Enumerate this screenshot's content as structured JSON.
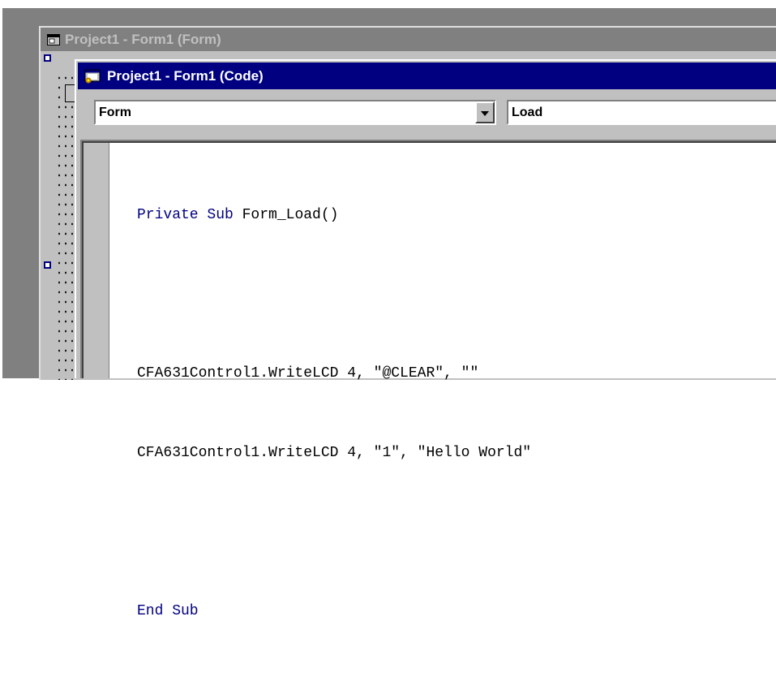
{
  "form_window": {
    "title": "Project1 - Form1 (Form)"
  },
  "code_window": {
    "title": "Project1 - Form1 (Code)",
    "object_dropdown": {
      "value": "Form"
    },
    "procedure_dropdown": {
      "value": "Load"
    }
  },
  "code": {
    "line1_kw": "Private Sub",
    "line1_rest": " Form_Load()",
    "line2": "",
    "line3": "CFA631Control1.WriteLCD 4, \"@CLEAR\", \"\"",
    "line4": "CFA631Control1.WriteLCD 4, \"1\", \"Hello World\"",
    "line5": "",
    "line6_kw": "End Sub"
  },
  "colors": {
    "active_title": "#000080",
    "inactive_title": "#808080",
    "keyword": "#000080",
    "face": "#c0c0c0"
  }
}
